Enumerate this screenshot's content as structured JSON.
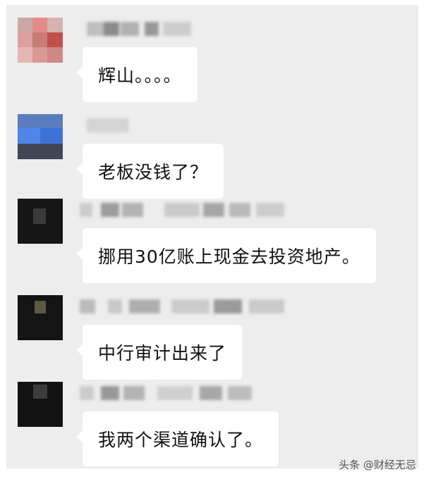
{
  "chat": {
    "messages": [
      {
        "text": "辉山。。。。"
      },
      {
        "text": "老板没钱了？"
      },
      {
        "text": "挪用30亿账上现金去投资地产。"
      },
      {
        "text": "中行审计出来了"
      },
      {
        "text": "我两个渠道确认了。"
      }
    ]
  },
  "watermark": {
    "text": "头条 @财经无忌"
  },
  "colors": {
    "panel_background": "#ededed",
    "bubble_background": "#ffffff",
    "text": "#111111"
  }
}
